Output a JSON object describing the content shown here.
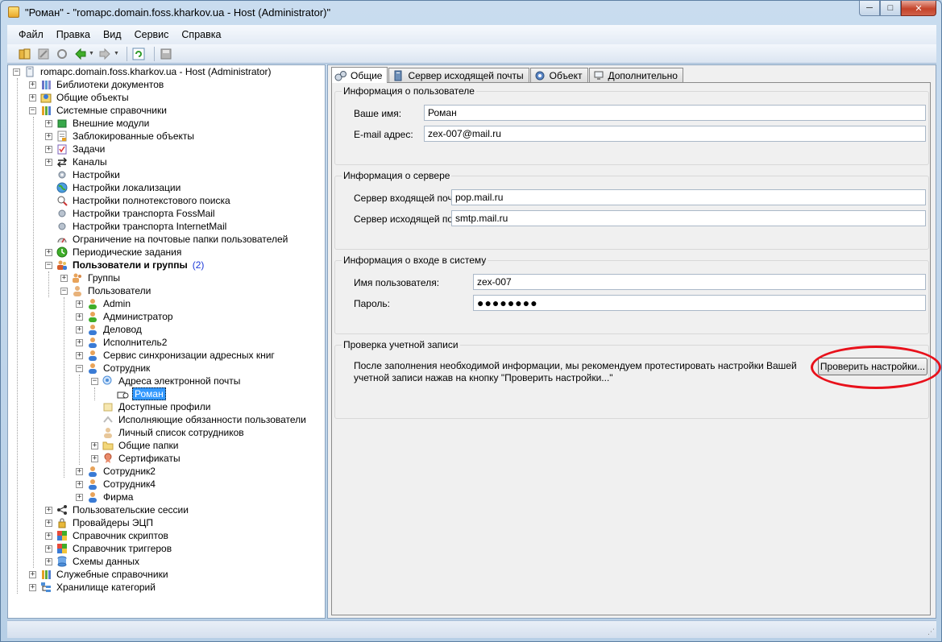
{
  "window": {
    "title": "\"Роман\" - \"romapc.domain.foss.kharkov.ua - Host (Administrator)\"",
    "minimize_glyph": "─",
    "maximize_glyph": "□",
    "close_glyph": "✕"
  },
  "menu": [
    {
      "label": "Файл"
    },
    {
      "label": "Правка"
    },
    {
      "label": "Вид"
    },
    {
      "label": "Сервис"
    },
    {
      "label": "Справка"
    }
  ],
  "toolbar": {
    "icons": [
      "open-icon",
      "disconnect-icon",
      "refresh-connection-icon",
      "back-arrow-icon",
      "forward-arrow-icon",
      "refresh-icon",
      "save-icon"
    ]
  },
  "tree": {
    "root": "romapc.domain.foss.kharkov.ua - Host (Administrator)",
    "items": [
      {
        "label": "Библиотеки документов"
      },
      {
        "label": "Общие объекты"
      },
      {
        "label": "Системные справочники"
      },
      {
        "label": "Внешние модули"
      },
      {
        "label": "Заблокированные объекты"
      },
      {
        "label": "Задачи"
      },
      {
        "label": "Каналы"
      },
      {
        "label": "Настройки"
      },
      {
        "label": "Настройки локализации"
      },
      {
        "label": "Настройки полнотекстового поиска"
      },
      {
        "label": "Настройки транспорта FossMail"
      },
      {
        "label": "Настройки транспорта InternetMail"
      },
      {
        "label": "Ограничение на почтовые папки пользователей"
      },
      {
        "label": "Периодические задания"
      },
      {
        "label": "Пользователи и группы",
        "count": "(2)"
      },
      {
        "label": "Группы"
      },
      {
        "label": "Пользователи"
      },
      {
        "label": "Admin"
      },
      {
        "label": "Администратор"
      },
      {
        "label": "Деловод"
      },
      {
        "label": "Исполнитель2"
      },
      {
        "label": "Сервис синхронизации адресных книг"
      },
      {
        "label": "Сотрудник"
      },
      {
        "label": "Адреса электронной почты"
      },
      {
        "label": "Роман"
      },
      {
        "label": "Доступные профили"
      },
      {
        "label": "Исполняющие обязанности пользователи"
      },
      {
        "label": "Личный список сотрудников"
      },
      {
        "label": "Общие папки"
      },
      {
        "label": "Сертификаты"
      },
      {
        "label": "Сотрудник2"
      },
      {
        "label": "Сотрудник4"
      },
      {
        "label": "Фирма"
      },
      {
        "label": "Пользовательские сессии"
      },
      {
        "label": "Провайдеры ЭЦП"
      },
      {
        "label": "Справочник скриптов"
      },
      {
        "label": "Справочник триггеров"
      },
      {
        "label": "Схемы данных"
      },
      {
        "label": "Служебные справочники"
      },
      {
        "label": "Хранилище категорий"
      }
    ]
  },
  "tabs": [
    {
      "label": "Общие"
    },
    {
      "label": "Сервер исходящей почты"
    },
    {
      "label": "Объект"
    },
    {
      "label": "Дополнительно"
    }
  ],
  "user_info": {
    "title": "Информация о пользователе",
    "name_label": "Ваше имя:",
    "name_value": "Роман",
    "email_label": "E-mail адрес:",
    "email_value": "zex-007@mail.ru"
  },
  "server_info": {
    "title": "Информация о сервере",
    "incoming_label": "Сервер входящей почты:",
    "incoming_value": "pop.mail.ru",
    "outgoing_label": "Сервер исходящей почты:",
    "outgoing_value": "smtp.mail.ru"
  },
  "login_info": {
    "title": "Информация о входе в систему",
    "username_label": "Имя пользователя:",
    "username_value": "zex-007",
    "password_label": "Пароль:",
    "password_value": "●●●●●●●●"
  },
  "account_check": {
    "title": "Проверка учетной записи",
    "text": "После заполнения необходимой информации, мы рекомендуем протестировать настройки Вашей учетной записи нажав на кнопку \"Проверить настройки...\"",
    "button_label": "Проверить настройки..."
  },
  "colors": {
    "selection": "#3399ff",
    "highlight_ring": "#e8111b",
    "count_text": "#1a37d8"
  }
}
